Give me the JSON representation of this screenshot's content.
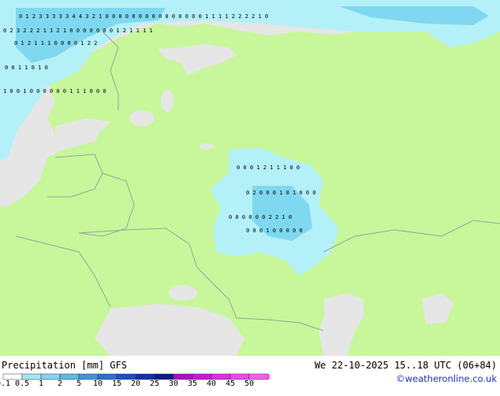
{
  "legend": {
    "title": "Precipitation [mm]  GFS",
    "valid_time": "We 22-10-2025 15..18 UTC (06+84)",
    "credit": "©weatheronline.co.uk",
    "tick_labels": [
      "0.1",
      "0.5",
      "1",
      "2",
      "5",
      "10",
      "15",
      "20",
      "25",
      "30",
      "35",
      "40",
      "45",
      "50"
    ],
    "colors": [
      "#ffffff",
      "#9ee8f8",
      "#7dd6f2",
      "#5ab9ea",
      "#3f93df",
      "#2a6fd3",
      "#1e4ec4",
      "#1331a8",
      "#0b1a8a",
      "#b00cc8",
      "#c81ad8",
      "#dc2ee6",
      "#ee44f0",
      "#f65cf6"
    ]
  },
  "map": {
    "land_color": "#c7f79a",
    "sea_color": "#e6e6e6",
    "border_color": "#9aa39a",
    "precip_light_color": "#b4f0f8",
    "precip_medium_color": "#7fd8f0",
    "point_value_rows": [
      {
        "text": "0 1 2 3 3 3 3 3 4 4 3 2 1 0 0 0 0 0 0 0 0 0 0 0 0 0 0 0 1 1 1 1 2 2 2 2 1 0"
      },
      {
        "text": "0 2 3 2 2 2 1 1 2 1 0 0                  0 0 0 0     0 1 2 1 1 1 1"
      },
      {
        "text": "0 1 2 1 1 1 0 0                                   0 0 1 2 2"
      },
      {
        "text": "0 0 1 1 0 1 0"
      },
      {
        "text": "1 0 0 1 0 0 0 0                      0 0 1 1 1 0 0 0"
      },
      {
        "text": "0 0 0 1 2 1 1 1 0 0"
      },
      {
        "text": "0 2 0 0 0 1 0 1     0 0 0"
      },
      {
        "text": "0 0 0 0 0 0 2 2 1 0"
      },
      {
        "text": "0 0 0 1 0 0 0 0 0"
      }
    ]
  }
}
